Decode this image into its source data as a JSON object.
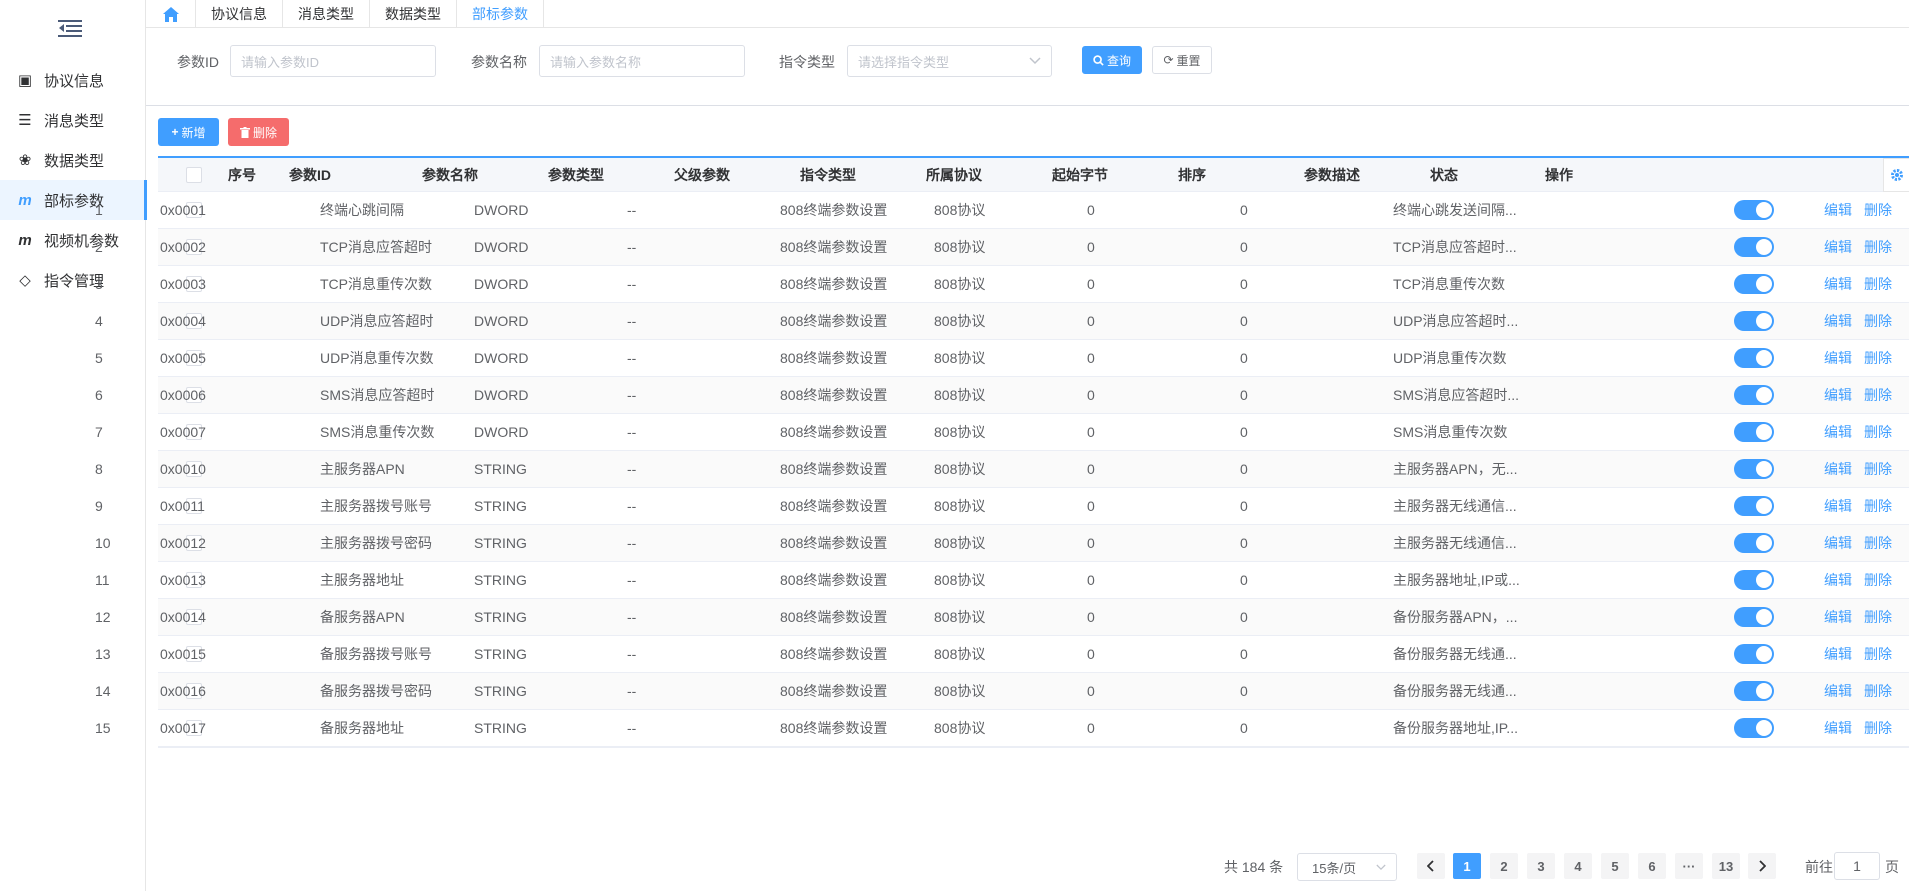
{
  "sidebar": {
    "items": [
      {
        "label": "协议信息",
        "icon": "bus-icon"
      },
      {
        "label": "消息类型",
        "icon": "list-icon"
      },
      {
        "label": "数据类型",
        "icon": "paw-icon"
      },
      {
        "label": "部标参数",
        "icon": "m-icon"
      },
      {
        "label": "视频机参数",
        "icon": "m-icon"
      },
      {
        "label": "指令管理",
        "icon": "code-icon"
      }
    ],
    "active_index": 3
  },
  "tabs": [
    {
      "label": "协议信息"
    },
    {
      "label": "消息类型"
    },
    {
      "label": "数据类型"
    },
    {
      "label": "部标参数",
      "active": true
    }
  ],
  "search": {
    "param_id_label": "参数ID",
    "param_id_placeholder": "请输入参数ID",
    "param_name_label": "参数名称",
    "param_name_placeholder": "请输入参数名称",
    "cmd_type_label": "指令类型",
    "cmd_type_placeholder": "请选择指令类型",
    "query_label": "查询",
    "reset_label": "重置"
  },
  "toolbar": {
    "add_label": "新增",
    "delete_label": "删除"
  },
  "table": {
    "columns": [
      "序号",
      "参数ID",
      "参数名称",
      "参数类型",
      "父级参数",
      "指令类型",
      "所属协议",
      "起始字节",
      "排序",
      "参数描述",
      "状态",
      "操作"
    ],
    "edit_label": "编辑",
    "delete_label": "删除",
    "rows": [
      {
        "no": "1",
        "id": "0x0001",
        "name": "终端心跳间隔",
        "type": "DWORD",
        "parent": "--",
        "cmd": "808终端参数设置",
        "proto": "808协议",
        "start": "0",
        "sort": "0",
        "desc": "终端心跳发送间隔...",
        "enabled": true
      },
      {
        "no": "2",
        "id": "0x0002",
        "name": "TCP消息应答超时",
        "type": "DWORD",
        "parent": "--",
        "cmd": "808终端参数设置",
        "proto": "808协议",
        "start": "0",
        "sort": "0",
        "desc": "TCP消息应答超时...",
        "enabled": true
      },
      {
        "no": "3",
        "id": "0x0003",
        "name": "TCP消息重传次数",
        "type": "DWORD",
        "parent": "--",
        "cmd": "808终端参数设置",
        "proto": "808协议",
        "start": "0",
        "sort": "0",
        "desc": "TCP消息重传次数",
        "enabled": true
      },
      {
        "no": "4",
        "id": "0x0004",
        "name": "UDP消息应答超时",
        "type": "DWORD",
        "parent": "--",
        "cmd": "808终端参数设置",
        "proto": "808协议",
        "start": "0",
        "sort": "0",
        "desc": "UDP消息应答超时...",
        "enabled": true
      },
      {
        "no": "5",
        "id": "0x0005",
        "name": "UDP消息重传次数",
        "type": "DWORD",
        "parent": "--",
        "cmd": "808终端参数设置",
        "proto": "808协议",
        "start": "0",
        "sort": "0",
        "desc": "UDP消息重传次数",
        "enabled": true
      },
      {
        "no": "6",
        "id": "0x0006",
        "name": "SMS消息应答超时",
        "type": "DWORD",
        "parent": "--",
        "cmd": "808终端参数设置",
        "proto": "808协议",
        "start": "0",
        "sort": "0",
        "desc": "SMS消息应答超时...",
        "enabled": true
      },
      {
        "no": "7",
        "id": "0x0007",
        "name": "SMS消息重传次数",
        "type": "DWORD",
        "parent": "--",
        "cmd": "808终端参数设置",
        "proto": "808协议",
        "start": "0",
        "sort": "0",
        "desc": "SMS消息重传次数",
        "enabled": true
      },
      {
        "no": "8",
        "id": "0x0010",
        "name": "主服务器APN",
        "type": "STRING",
        "parent": "--",
        "cmd": "808终端参数设置",
        "proto": "808协议",
        "start": "0",
        "sort": "0",
        "desc": "主服务器APN，无...",
        "enabled": true
      },
      {
        "no": "9",
        "id": "0x0011",
        "name": "主服务器拨号账号",
        "type": "STRING",
        "parent": "--",
        "cmd": "808终端参数设置",
        "proto": "808协议",
        "start": "0",
        "sort": "0",
        "desc": "主服务器无线通信...",
        "enabled": true
      },
      {
        "no": "10",
        "id": "0x0012",
        "name": "主服务器拨号密码",
        "type": "STRING",
        "parent": "--",
        "cmd": "808终端参数设置",
        "proto": "808协议",
        "start": "0",
        "sort": "0",
        "desc": "主服务器无线通信...",
        "enabled": true
      },
      {
        "no": "11",
        "id": "0x0013",
        "name": "主服务器地址",
        "type": "STRING",
        "parent": "--",
        "cmd": "808终端参数设置",
        "proto": "808协议",
        "start": "0",
        "sort": "0",
        "desc": "主服务器地址,IP或...",
        "enabled": true
      },
      {
        "no": "12",
        "id": "0x0014",
        "name": "备服务器APN",
        "type": "STRING",
        "parent": "--",
        "cmd": "808终端参数设置",
        "proto": "808协议",
        "start": "0",
        "sort": "0",
        "desc": "备份服务器APN，...",
        "enabled": true
      },
      {
        "no": "13",
        "id": "0x0015",
        "name": "备服务器拨号账号",
        "type": "STRING",
        "parent": "--",
        "cmd": "808终端参数设置",
        "proto": "808协议",
        "start": "0",
        "sort": "0",
        "desc": "备份服务器无线通...",
        "enabled": true
      },
      {
        "no": "14",
        "id": "0x0016",
        "name": "备服务器拨号密码",
        "type": "STRING",
        "parent": "--",
        "cmd": "808终端参数设置",
        "proto": "808协议",
        "start": "0",
        "sort": "0",
        "desc": "备份服务器无线通...",
        "enabled": true
      },
      {
        "no": "15",
        "id": "0x0017",
        "name": "备服务器地址",
        "type": "STRING",
        "parent": "--",
        "cmd": "808终端参数设置",
        "proto": "808协议",
        "start": "0",
        "sort": "0",
        "desc": "备份服务器地址,IP...",
        "enabled": true
      }
    ]
  },
  "pagination": {
    "total_text": "共 184 条",
    "page_size_text": "15条/页",
    "pages": [
      "1",
      "2",
      "3",
      "4",
      "5",
      "6",
      "···",
      "13"
    ],
    "current_page": "1",
    "goto_prefix": "前往",
    "goto_value": "1",
    "goto_suffix": "页"
  },
  "colors": {
    "primary": "#409eff",
    "danger": "#f56c6c",
    "header_bg": "#f5f7fa"
  }
}
